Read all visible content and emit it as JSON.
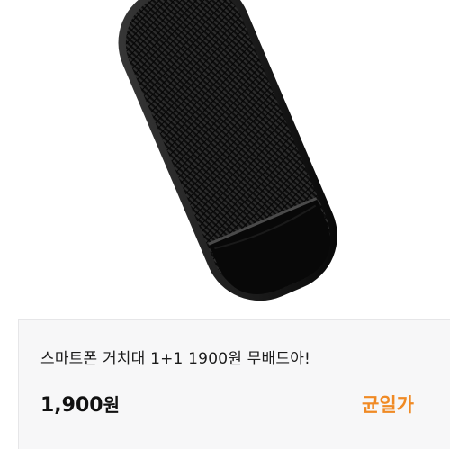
{
  "product": {
    "image": {
      "description": "black-anti-slip-pad-icon"
    },
    "title": "스마트폰 거치대 1+1 1900원 무배드아!",
    "price": {
      "amount": "1,900",
      "unit": "원"
    },
    "tag": {
      "label": "균일가",
      "color": "#f08a24"
    }
  },
  "colors": {
    "card_bg": "#f7f7f8",
    "card_border": "#e6e6e8",
    "accent": "#f08a24"
  }
}
